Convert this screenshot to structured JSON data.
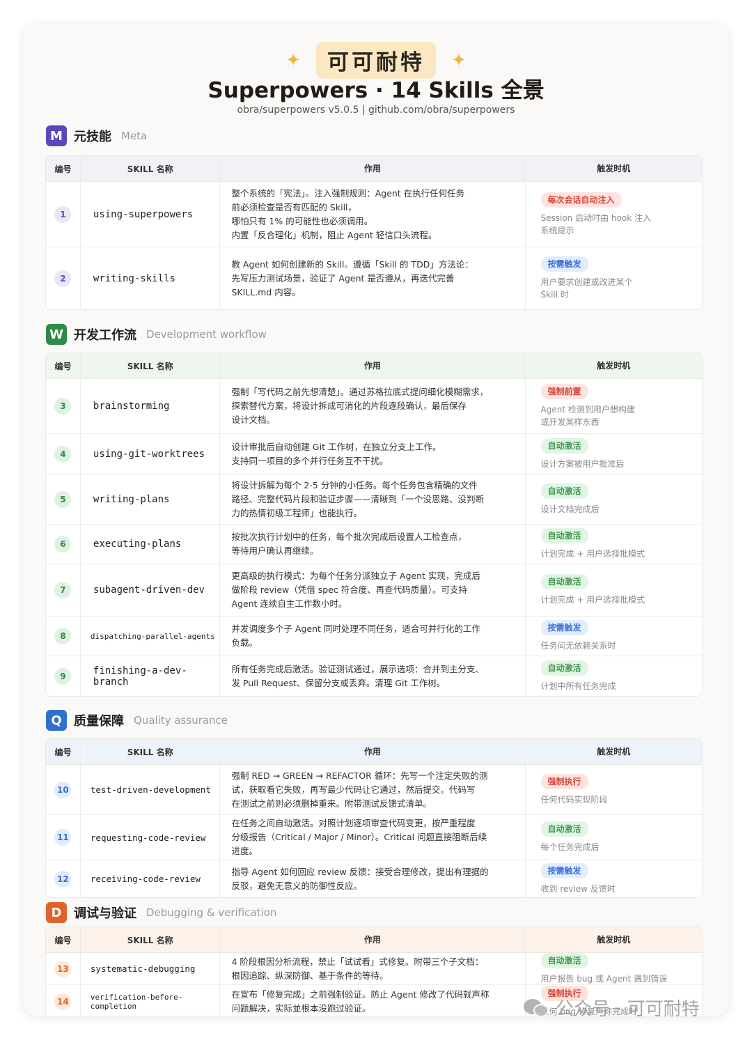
{
  "header": {
    "brand": "可可耐特",
    "title": "Superpowers · 14 Skills 全景",
    "subtitle": "obra/superpowers v5.0.5  |  github.com/obra/superpowers"
  },
  "columns": {
    "num": "编号",
    "name": "SKILL 名称",
    "desc": "作用",
    "trigger": "触发时机"
  },
  "sections": [
    {
      "badge": "M",
      "title_zh": "元技能",
      "title_en": "Meta",
      "color": "#5b46c0",
      "rows": [
        {
          "num": "1",
          "name": "using-superpowers",
          "desc": [
            "整个系统的「宪法」。注入强制规则：Agent 在执行任何任务",
            "前必须检查是否有匹配的 Skill，",
            "哪怕只有 1% 的可能性也必须调用。",
            "内置「反合理化」机制，阻止 Agent 轻信口头流程。"
          ],
          "tag": "每次会话自动注入",
          "tag_type": "red",
          "trigger": [
            "Session 启动时由 hook 注入",
            "系统提示"
          ]
        },
        {
          "num": "2",
          "name": "writing-skills",
          "desc": [
            "教 Agent 如何创建新的 Skill。遵循「Skill 的 TDD」方法论：",
            "先写压力测试场景，验证了 Agent 是否遵从，再迭代完善",
            "SKILL.md 内容。"
          ],
          "tag": "按需触发",
          "tag_type": "blue",
          "trigger": [
            "用户要求创建或改进某个",
            "Skill 时"
          ]
        }
      ]
    },
    {
      "badge": "W",
      "title_zh": "开发工作流",
      "title_en": "Development workflow",
      "color": "#2f8a45",
      "rows": [
        {
          "num": "3",
          "name": "brainstorming",
          "desc": [
            "强制「写代码之前先想清楚」。通过苏格拉底式提问细化模糊需求，",
            "探索替代方案，将设计拆成可消化的片段逐段确认，最后保存",
            "设计文档。"
          ],
          "tag": "强制前置",
          "tag_type": "red",
          "trigger": [
            "Agent 检测到用户想构建",
            "或开发某样东西"
          ]
        },
        {
          "num": "4",
          "name": "using-git-worktrees",
          "desc": [
            "设计审批后自动创建 Git 工作树，在独立分支上工作。",
            "支持同一项目的多个并行任务互不干扰。"
          ],
          "tag": "自动激活",
          "tag_type": "green",
          "trigger": [
            "设计方案被用户批准后"
          ]
        },
        {
          "num": "5",
          "name": "writing-plans",
          "desc": [
            "将设计拆解为每个 2-5 分钟的小任务。每个任务包含精确的文件",
            "路径、完整代码片段和验证步骤——清晰到「一个没思路、没判断",
            "力的热情初级工程师」也能执行。"
          ],
          "tag": "自动激活",
          "tag_type": "green",
          "trigger": [
            "设计文档完成后"
          ]
        },
        {
          "num": "6",
          "name": "executing-plans",
          "desc": [
            "按批次执行计划中的任务，每个批次完成后设置人工检查点，",
            "等待用户确认再继续。"
          ],
          "tag": "自动激活",
          "tag_type": "green",
          "trigger": [
            "计划完成 + 用户选择批模式"
          ]
        },
        {
          "num": "7",
          "name": "subagent-driven-dev",
          "desc": [
            "更高级的执行模式：为每个任务分派独立子 Agent 实现，完成后",
            "做阶段 review（凭借 spec 符合度、再查代码质量）。可支持",
            "Agent 连续自主工作数小时。"
          ],
          "tag": "自动激活",
          "tag_type": "green",
          "trigger": [
            "计划完成 + 用户选择批模式"
          ]
        },
        {
          "num": "8",
          "name": "dispatching-parallel-agents",
          "desc": [
            "并发调度多个子 Agent 同时处理不同任务，适合可并行化的工作",
            "负载。"
          ],
          "tag": "按需触发",
          "tag_type": "blue",
          "trigger": [
            "任务间无依赖关系时"
          ]
        },
        {
          "num": "9",
          "name": "finishing-a-dev-branch",
          "desc": [
            "所有任务完成后激活。验证测试通过，展示选项：合并到主分支、",
            "发 Pull Request、保留分支或丢弃。清理 Git 工作树。"
          ],
          "tag": "自动激活",
          "tag_type": "green",
          "trigger": [
            "计划中所有任务完成"
          ]
        }
      ]
    },
    {
      "badge": "Q",
      "title_zh": "质量保障",
      "title_en": "Quality assurance",
      "color": "#2f6fd0",
      "rows": [
        {
          "num": "10",
          "name": "test-driven-development",
          "desc": [
            "强制 RED → GREEN → REFACTOR 循环：先写一个注定失败的测",
            "试，获取看它失败，再写最少代码让它通过，然后提交。代码写",
            "在测试之前则必须删掉重来。附带测试反馈式清单。"
          ],
          "tag": "强制执行",
          "tag_type": "red",
          "trigger": [
            "任何代码实现阶段"
          ]
        },
        {
          "num": "11",
          "name": "requesting-code-review",
          "desc": [
            "在任务之间自动激活。对照计划逐项审查代码变更，按严重程度",
            "分级报告（Critical / Major / Minor）。Critical 问题直接阻断后续",
            "进度。"
          ],
          "tag": "自动激活",
          "tag_type": "green",
          "trigger": [
            "每个任务完成后"
          ]
        },
        {
          "num": "12",
          "name": "receiving-code-review",
          "desc": [
            "指导 Agent 如何回应 review 反馈：接受合理修改，提出有理据的",
            "反驳，避免无意义的防御性反应。"
          ],
          "tag": "按需触发",
          "tag_type": "blue",
          "trigger": [
            "收到 review 反馈时"
          ]
        }
      ]
    },
    {
      "badge": "D",
      "title_zh": "调试与验证",
      "title_en": "Debugging & verification",
      "color": "#e0642a",
      "rows": [
        {
          "num": "13",
          "name": "systematic-debugging",
          "desc": [
            "4 阶段根因分析流程，禁止「试试看」式修复。附带三个子文档：",
            "根因追踪、纵深防御、基于条件的等待。"
          ],
          "tag": "自动激活",
          "tag_type": "green",
          "trigger": [
            "用户报告 bug 或 Agent 遇到错误"
          ]
        },
        {
          "num": "14",
          "name": "verification-before-completion",
          "desc": [
            "在宣布「修复完成」之前强制验证。防止 Agent 修改了代码就声称",
            "问题解决，实际並根本没跑过验证。"
          ],
          "tag": "强制执行",
          "tag_type": "red",
          "trigger": [
            "任何 bug 修复声称完成时"
          ]
        }
      ]
    }
  ],
  "watermark": "公众号 · 可可耐特"
}
